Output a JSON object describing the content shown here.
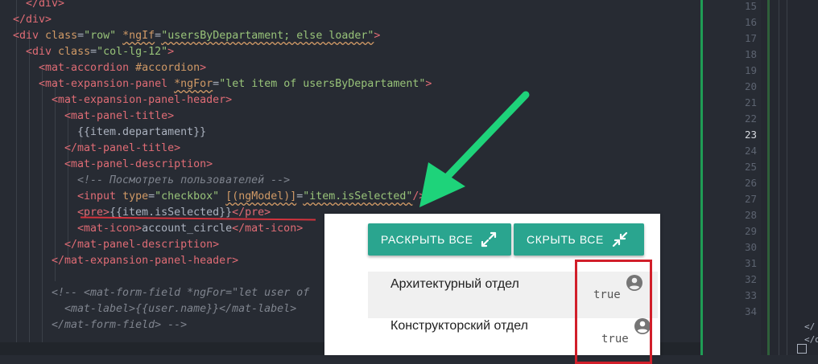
{
  "editor": {
    "lines": [
      {
        "id": "l1",
        "segs": [
          {
            "t": "tag",
            "v": "</div>"
          }
        ]
      },
      {
        "id": "l2",
        "segs": [
          {
            "t": "tag",
            "v": "</div>"
          }
        ]
      },
      {
        "id": "l3",
        "segs": [
          {
            "t": "tag",
            "v": "<div"
          },
          {
            "t": "txt",
            "v": " "
          },
          {
            "t": "attr",
            "v": "class"
          },
          {
            "t": "txt",
            "v": "="
          },
          {
            "t": "str",
            "v": "\"row\""
          },
          {
            "t": "txt",
            "v": " "
          },
          {
            "t": "attr-sq",
            "v": "*ngIf"
          },
          {
            "t": "txt",
            "v": "="
          },
          {
            "t": "str-sq",
            "v": "\"usersByDepartament; else loader\""
          },
          {
            "t": "tag",
            "v": ">"
          }
        ]
      },
      {
        "id": "l4",
        "segs": [
          {
            "t": "tag",
            "v": "<div"
          },
          {
            "t": "txt",
            "v": " "
          },
          {
            "t": "attr",
            "v": "class"
          },
          {
            "t": "txt",
            "v": "="
          },
          {
            "t": "str",
            "v": "\"col-lg-12\""
          },
          {
            "t": "tag",
            "v": ">"
          }
        ]
      },
      {
        "id": "l5",
        "segs": [
          {
            "t": "tag",
            "v": "<mat-accordion"
          },
          {
            "t": "txt",
            "v": " "
          },
          {
            "t": "attr",
            "v": "#accordion"
          },
          {
            "t": "tag",
            "v": ">"
          }
        ]
      },
      {
        "id": "l6",
        "segs": [
          {
            "t": "tag",
            "v": "<mat-expansion-panel"
          },
          {
            "t": "txt",
            "v": " "
          },
          {
            "t": "attr-sq",
            "v": "*ngFor"
          },
          {
            "t": "txt",
            "v": "="
          },
          {
            "t": "str",
            "v": "\"let item of usersByDepartament\""
          },
          {
            "t": "tag",
            "v": ">"
          }
        ]
      },
      {
        "id": "l7",
        "segs": [
          {
            "t": "tag",
            "v": "<mat-expansion-panel-header>"
          }
        ]
      },
      {
        "id": "l8",
        "segs": [
          {
            "t": "tag",
            "v": "<mat-panel-title>"
          }
        ]
      },
      {
        "id": "l9",
        "segs": [
          {
            "t": "txt",
            "v": "{{item.departament}}"
          }
        ]
      },
      {
        "id": "l10",
        "segs": [
          {
            "t": "tag",
            "v": "</mat-panel-title>"
          }
        ]
      },
      {
        "id": "l11",
        "segs": [
          {
            "t": "tag",
            "v": "<mat-panel-description>"
          }
        ]
      },
      {
        "id": "l12",
        "segs": [
          {
            "t": "cmt",
            "v": "<!-- Посмотреть пользователей -->"
          }
        ]
      },
      {
        "id": "l13",
        "segs": [
          {
            "t": "tag",
            "v": "<input"
          },
          {
            "t": "txt",
            "v": " "
          },
          {
            "t": "attr",
            "v": "type"
          },
          {
            "t": "txt",
            "v": "="
          },
          {
            "t": "str",
            "v": "\"checkbox\""
          },
          {
            "t": "txt",
            "v": " "
          },
          {
            "t": "attr-sq",
            "v": "[(ngModel)]"
          },
          {
            "t": "txt",
            "v": "="
          },
          {
            "t": "str-sq",
            "v": "\"item.isSelected\""
          },
          {
            "t": "tag",
            "v": "/>"
          }
        ]
      },
      {
        "id": "l14",
        "segs": [
          {
            "t": "tag",
            "v": "<pre>"
          },
          {
            "t": "txt",
            "v": "{{item.isSelected}}"
          },
          {
            "t": "tag",
            "v": "</pre>"
          }
        ]
      },
      {
        "id": "l15",
        "segs": [
          {
            "t": "tag",
            "v": "<mat-icon>"
          },
          {
            "t": "txt",
            "v": "account_circle"
          },
          {
            "t": "tag",
            "v": "</mat-icon>"
          }
        ]
      },
      {
        "id": "l16",
        "segs": [
          {
            "t": "tag",
            "v": "</mat-panel-description>"
          }
        ]
      },
      {
        "id": "l17",
        "segs": [
          {
            "t": "tag",
            "v": "</mat-expansion-panel-header>"
          }
        ]
      },
      {
        "id": "l18",
        "segs": []
      },
      {
        "id": "l19",
        "segs": [
          {
            "t": "cmt",
            "v": "<!-- <mat-form-field *ngFor=\"let user of"
          }
        ]
      },
      {
        "id": "l20",
        "segs": [
          {
            "t": "cmt",
            "v": "<mat-label>{{user.name}}</mat-label>"
          }
        ]
      },
      {
        "id": "l21",
        "segs": [
          {
            "t": "cmt",
            "v": "</mat-form-field> -->"
          }
        ]
      }
    ]
  },
  "gutter": {
    "numbers": [
      "15",
      "16",
      "17",
      "18",
      "19",
      "20",
      "21",
      "22",
      "23",
      "24",
      "25",
      "26",
      "27",
      "28",
      "29",
      "30",
      "31",
      "32",
      "33",
      "34"
    ],
    "current": "23"
  },
  "panel": {
    "expand_all_label": "РАСКРЫТЬ ВСЕ",
    "collapse_all_label": "СКРЫТЬ ВСЕ",
    "rows": [
      {
        "title": "Архитектурный отдел",
        "selected": "true"
      },
      {
        "title": "Конструкторский отдел",
        "selected": "true"
      }
    ]
  },
  "annotation": {
    "arrow_color": "#1ed37a",
    "underline_color": "#d3323c",
    "box_color": "#d11f2a",
    "accent": "#2aa58f"
  }
}
